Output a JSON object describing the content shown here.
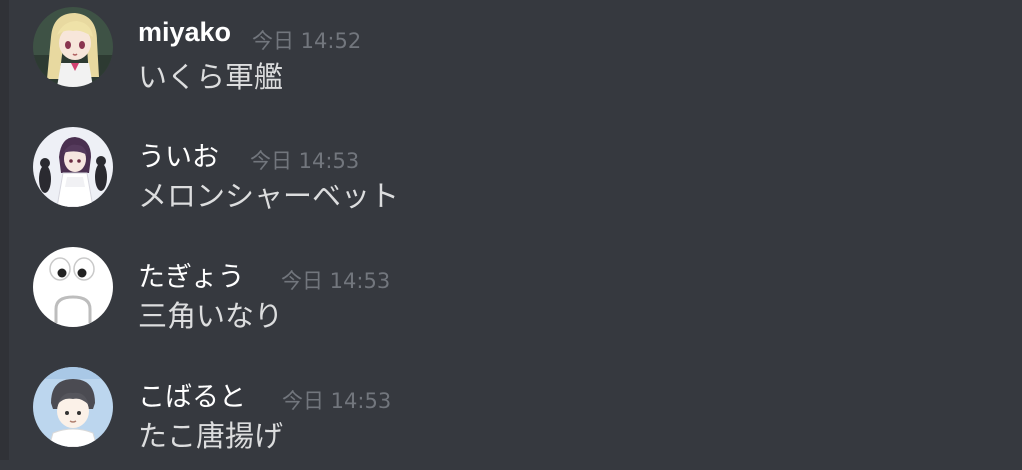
{
  "colors": {
    "background": "#36393f",
    "username": "#ffffff",
    "timestamp": "#72767d",
    "message_text": "#dcddde"
  },
  "messages": [
    {
      "author": "miyako",
      "timestamp": "今日 14:52",
      "content": "いくら軍艦",
      "avatar_icon": "anime-girl-blonde-avatar"
    },
    {
      "author": "ういお",
      "timestamp": "今日 14:53",
      "content": "メロンシャーベット",
      "avatar_icon": "anime-girl-dark-hair-avatar"
    },
    {
      "author": "たぎょう",
      "timestamp": "今日 14:53",
      "content": "三角いなり",
      "avatar_icon": "surprised-face-avatar"
    },
    {
      "author": "こばると",
      "timestamp": "今日 14:53",
      "content": "たこ唐揚げ",
      "avatar_icon": "anime-boy-avatar"
    }
  ]
}
